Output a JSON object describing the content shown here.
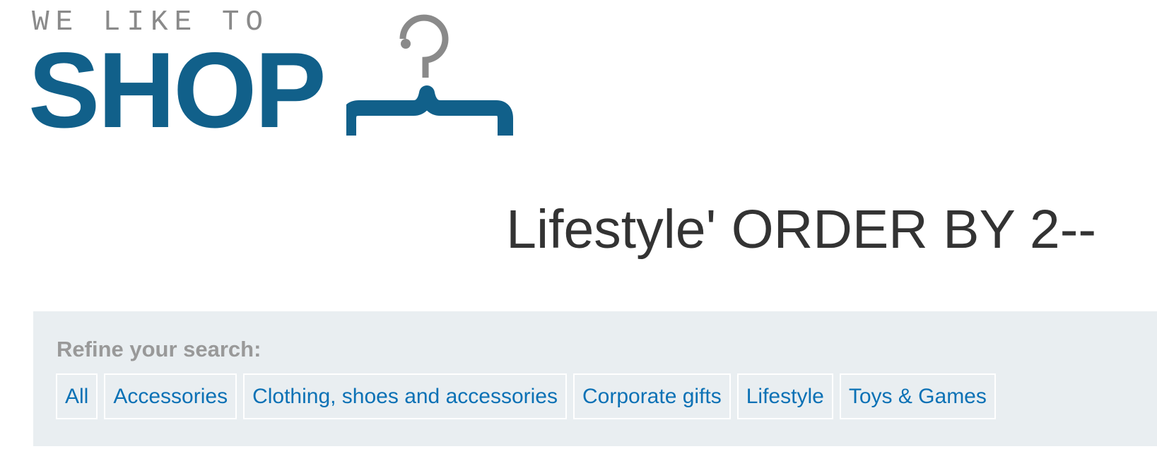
{
  "logo": {
    "tagline": "WE LIKE TO",
    "word": "SHOP",
    "icon": "clothes-hanger-icon",
    "colors": {
      "tagline": "#8a8a8a",
      "word": "#11608a",
      "hook": "#8a8a8a"
    }
  },
  "page": {
    "title": "Lifestyle' ORDER BY 2--"
  },
  "filters": {
    "heading": "Refine your search:",
    "categories": [
      {
        "label": "All"
      },
      {
        "label": "Accessories"
      },
      {
        "label": "Clothing, shoes and accessories"
      },
      {
        "label": "Corporate gifts"
      },
      {
        "label": "Lifestyle"
      },
      {
        "label": "Toys & Games"
      }
    ]
  },
  "colors": {
    "panel_background": "#e9eef1",
    "link": "#0b71b5",
    "title_text": "#333333",
    "heading_text": "#999999"
  }
}
